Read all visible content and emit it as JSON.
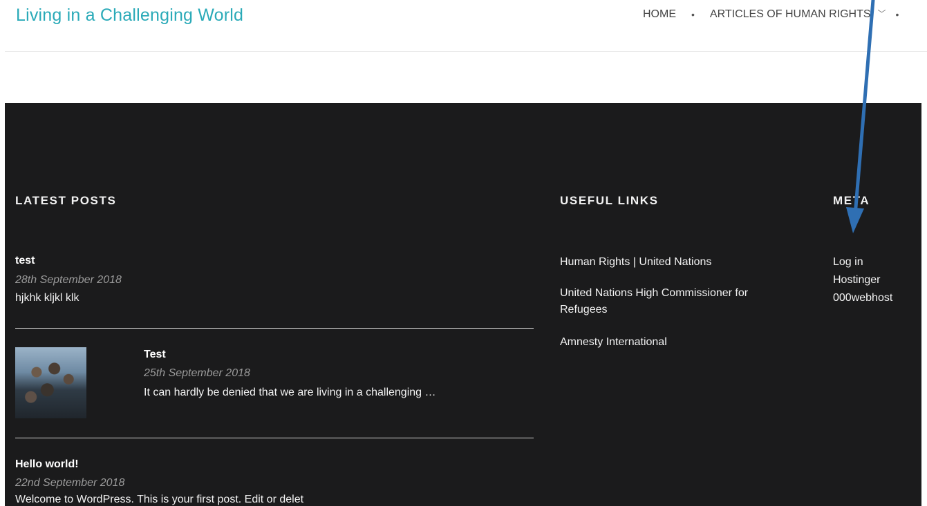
{
  "header": {
    "site_title": "Living in a Challenging World",
    "nav": [
      {
        "label": "HOME"
      },
      {
        "label": "ARTICLES OF HUMAN RIGHTS"
      }
    ]
  },
  "footer": {
    "latest_posts": {
      "title": "LATEST POSTS",
      "posts": [
        {
          "title": "test",
          "date": "28th September 2018",
          "excerpt": "hjkhk kljkl klk"
        },
        {
          "title": "Test",
          "date": "25th September 2018",
          "excerpt": "It can hardly be denied that we are living in a challenging …"
        },
        {
          "title": "Hello world!",
          "date": "22nd September 2018",
          "excerpt": "Welcome to WordPress. This is your first post. Edit or delet"
        }
      ]
    },
    "useful_links": {
      "title": "USEFUL LINKS",
      "links": [
        {
          "label": "Human Rights | United Nations"
        },
        {
          "label": "United Nations High Commissioner for Refugees"
        },
        {
          "label": "Amnesty International"
        }
      ]
    },
    "meta": {
      "title": "META",
      "links": [
        {
          "label": "Log in"
        },
        {
          "label": "Hostinger"
        },
        {
          "label": "000webhost"
        }
      ]
    }
  },
  "colors": {
    "site_title": "#2aaab8",
    "footer_bg": "#1b1b1c",
    "annotation_arrow": "#2f6fb3"
  }
}
